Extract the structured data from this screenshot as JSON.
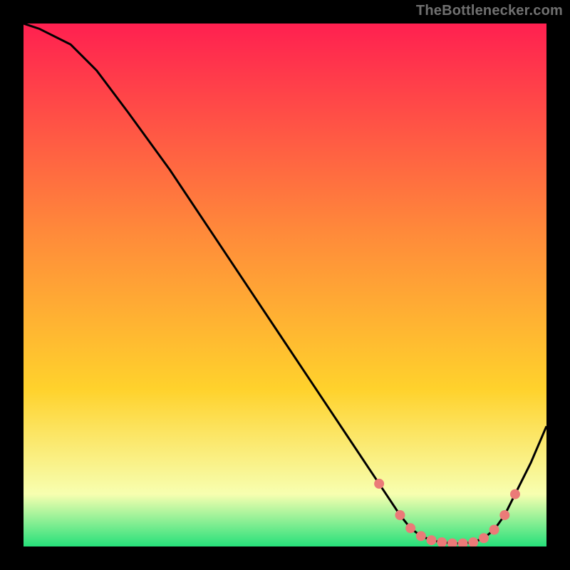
{
  "attribution": "TheBottlenecker.com",
  "chart_data": {
    "type": "line",
    "title": "",
    "xlabel": "",
    "ylabel": "",
    "xlim": [
      0,
      100
    ],
    "ylim": [
      0,
      100
    ],
    "x": [
      0,
      3,
      9,
      14,
      20,
      28,
      36,
      44,
      52,
      58,
      62,
      66,
      70,
      72,
      74,
      76,
      78,
      80,
      82,
      84,
      86,
      88,
      90,
      92,
      94,
      97,
      100
    ],
    "y": [
      100,
      99,
      96,
      91,
      83,
      72,
      60,
      48,
      36,
      27,
      21,
      15,
      9,
      6,
      3.5,
      2,
      1.2,
      0.8,
      0.6,
      0.6,
      0.8,
      1.6,
      3.2,
      6,
      10,
      16,
      23
    ],
    "markers": {
      "x": [
        68,
        72,
        74,
        76,
        78,
        80,
        82,
        84,
        86,
        88,
        90,
        92,
        94
      ],
      "y": [
        12,
        6,
        3.5,
        2,
        1.2,
        0.8,
        0.6,
        0.6,
        0.8,
        1.6,
        3.2,
        6,
        10
      ]
    },
    "colors": {
      "gradient_top": "#ff2050",
      "gradient_mid": "#ffd22c",
      "gradient_low": "#f7ffb0",
      "gradient_bottom": "#26e07a",
      "line": "#000000",
      "marker": "#eb7a78"
    }
  }
}
